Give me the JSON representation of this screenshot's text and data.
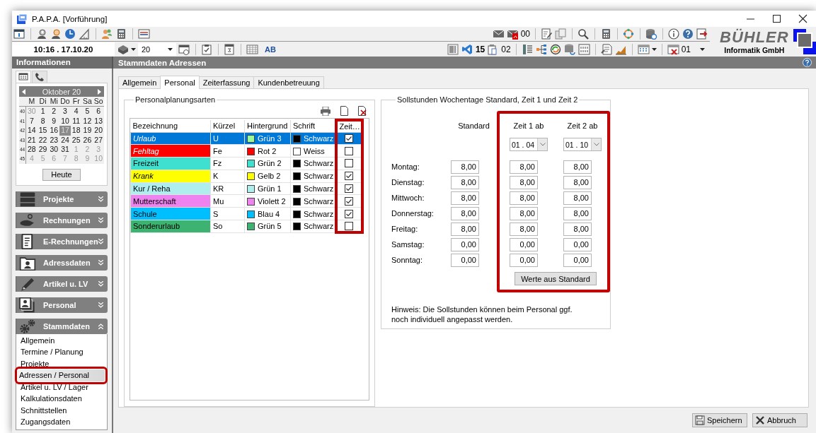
{
  "window": {
    "title": "P.A.P.A. [Vorführung]"
  },
  "toolbar": {
    "datetime": "10:16 . 17.10.20",
    "year": "20",
    "ab_label": "AB",
    "mail_count": "00",
    "vs_count": "15",
    "clip_count": "02",
    "grid_count": "01"
  },
  "logo": {
    "name": "BÜHLER",
    "subtitle": "Informatik GmbH"
  },
  "info_header": "Informationen",
  "page_header": "Stammdaten Adressen",
  "calendar_tabs": [
    {
      "kind": "calendar",
      "selected": true
    },
    {
      "kind": "phone",
      "selected": false
    }
  ],
  "calendar": {
    "month": "Oktober 20",
    "weekdays": [
      "M",
      "Di",
      "Mi",
      "Do",
      "Fr",
      "Sa",
      "So"
    ],
    "today_button": "Heute",
    "weeks": [
      {
        "number": "40",
        "days": [
          {
            "label": "30",
            "other_month": true,
            "selected": false
          },
          {
            "label": "1",
            "other_month": false,
            "selected": false
          },
          {
            "label": "2",
            "other_month": false,
            "selected": false
          },
          {
            "label": "3",
            "other_month": false,
            "selected": false
          },
          {
            "label": "4",
            "other_month": false,
            "selected": false
          },
          {
            "label": "5",
            "other_month": false,
            "selected": false
          },
          {
            "label": "6",
            "other_month": false,
            "selected": false
          }
        ]
      },
      {
        "number": "41",
        "days": [
          {
            "label": "7",
            "other_month": false,
            "selected": false
          },
          {
            "label": "8",
            "other_month": false,
            "selected": false
          },
          {
            "label": "9",
            "other_month": false,
            "selected": false
          },
          {
            "label": "10",
            "other_month": false,
            "selected": false
          },
          {
            "label": "11",
            "other_month": false,
            "selected": false
          },
          {
            "label": "12",
            "other_month": false,
            "selected": false
          },
          {
            "label": "13",
            "other_month": false,
            "selected": false
          }
        ]
      },
      {
        "number": "42",
        "days": [
          {
            "label": "14",
            "other_month": false,
            "selected": false
          },
          {
            "label": "15",
            "other_month": false,
            "selected": false
          },
          {
            "label": "16",
            "other_month": false,
            "selected": false
          },
          {
            "label": "17",
            "other_month": false,
            "selected": true
          },
          {
            "label": "18",
            "other_month": false,
            "selected": false
          },
          {
            "label": "19",
            "other_month": false,
            "selected": false
          },
          {
            "label": "20",
            "other_month": false,
            "selected": false
          }
        ]
      },
      {
        "number": "43",
        "days": [
          {
            "label": "21",
            "other_month": false,
            "selected": false
          },
          {
            "label": "22",
            "other_month": false,
            "selected": false
          },
          {
            "label": "23",
            "other_month": false,
            "selected": false
          },
          {
            "label": "24",
            "other_month": false,
            "selected": false
          },
          {
            "label": "25",
            "other_month": false,
            "selected": false
          },
          {
            "label": "26",
            "other_month": false,
            "selected": false
          },
          {
            "label": "27",
            "other_month": false,
            "selected": false
          }
        ]
      },
      {
        "number": "44",
        "days": [
          {
            "label": "28",
            "other_month": false,
            "selected": false
          },
          {
            "label": "29",
            "other_month": false,
            "selected": false
          },
          {
            "label": "30",
            "other_month": false,
            "selected": false
          },
          {
            "label": "31",
            "other_month": false,
            "selected": false
          },
          {
            "label": "1",
            "other_month": true,
            "selected": false
          },
          {
            "label": "2",
            "other_month": true,
            "selected": false
          },
          {
            "label": "3",
            "other_month": true,
            "selected": false
          }
        ]
      },
      {
        "number": "45",
        "days": [
          {
            "label": "4",
            "other_month": true,
            "selected": false
          },
          {
            "label": "5",
            "other_month": true,
            "selected": false
          },
          {
            "label": "6",
            "other_month": true,
            "selected": false
          },
          {
            "label": "7",
            "other_month": true,
            "selected": false
          },
          {
            "label": "8",
            "other_month": true,
            "selected": false
          },
          {
            "label": "9",
            "other_month": true,
            "selected": false
          },
          {
            "label": "10",
            "other_month": true,
            "selected": false
          }
        ]
      }
    ]
  },
  "nav_groups": [
    {
      "label": "Projekte",
      "kind": "server",
      "expanded": false
    },
    {
      "label": "Rechnungen",
      "kind": "hand",
      "expanded": false
    },
    {
      "label": "E-Rechnungen",
      "kind": "document",
      "expanded": false
    },
    {
      "label": "Adressdaten",
      "kind": "folder",
      "expanded": false
    },
    {
      "label": "Artikel u. LV",
      "kind": "pen",
      "expanded": false
    },
    {
      "label": "Personal",
      "kind": "photos",
      "expanded": false
    },
    {
      "label": "Stammdaten",
      "kind": "gears",
      "expanded": true,
      "items": [
        {
          "label": "Allgemein",
          "selected": false,
          "highlighted": false
        },
        {
          "label": "Termine / Planung",
          "selected": false,
          "highlighted": false
        },
        {
          "label": "Projekte",
          "selected": false,
          "highlighted": false
        },
        {
          "label": "Adressen / Personal",
          "selected": true,
          "highlighted": true
        },
        {
          "label": "Artikel u. LV / Lager",
          "selected": false,
          "highlighted": false
        },
        {
          "label": "Kalkulationsdaten",
          "selected": false,
          "highlighted": false
        },
        {
          "label": "Schnittstellen",
          "selected": false,
          "highlighted": false
        },
        {
          "label": "Zugangsdaten",
          "selected": false,
          "highlighted": false
        }
      ]
    }
  ],
  "tabs": [
    {
      "label": "Allgemein",
      "selected": false
    },
    {
      "label": "Personal",
      "selected": true
    },
    {
      "label": "Zeiterfassung",
      "selected": false
    },
    {
      "label": "Kundenbetreuung",
      "selected": false
    }
  ],
  "planning": {
    "title": "Personalplanungsarten",
    "columns": [
      {
        "label": "Bezeichnung",
        "highlighted": false
      },
      {
        "label": "Kürzel",
        "highlighted": false
      },
      {
        "label": "Hintergrund",
        "highlighted": false
      },
      {
        "label": "Schrift",
        "highlighted": false
      },
      {
        "label": "Zeit…",
        "highlighted": true
      }
    ],
    "rows": [
      {
        "name": "Urlaub",
        "italic": true,
        "selected": true,
        "code": "U",
        "background": {
          "label": "Grün 3",
          "color": "#98fb98"
        },
        "font": {
          "label": "Schwarz",
          "color": "#000000"
        },
        "zeit": true
      },
      {
        "name": "Fehltag",
        "italic": true,
        "selected": false,
        "code": "Fe",
        "background": {
          "label": "Rot 2",
          "color": "#ff0000"
        },
        "font": {
          "label": "Weiss",
          "color": "#ffffff"
        },
        "zeit": false
      },
      {
        "name": "Freizeit",
        "italic": false,
        "selected": false,
        "code": "Fz",
        "background": {
          "label": "Grün 2",
          "color": "#40e0d0"
        },
        "font": {
          "label": "Schwarz",
          "color": "#000000"
        },
        "zeit": false
      },
      {
        "name": "Krank",
        "italic": true,
        "selected": false,
        "code": "K",
        "background": {
          "label": "Gelb 2",
          "color": "#ffff00"
        },
        "font": {
          "label": "Schwarz",
          "color": "#000000"
        },
        "zeit": true
      },
      {
        "name": "Kur / Reha",
        "italic": false,
        "selected": false,
        "code": "KR",
        "background": {
          "label": "Grün 1",
          "color": "#afeeee"
        },
        "font": {
          "label": "Schwarz",
          "color": "#000000"
        },
        "zeit": true
      },
      {
        "name": "Mutterschaft",
        "italic": false,
        "selected": false,
        "code": "Mu",
        "background": {
          "label": "Violett 2",
          "color": "#ee82ee"
        },
        "font": {
          "label": "Schwarz",
          "color": "#000000"
        },
        "zeit": true
      },
      {
        "name": "Schule",
        "italic": false,
        "selected": false,
        "code": "S",
        "background": {
          "label": "Blau 4",
          "color": "#00bfff"
        },
        "font": {
          "label": "Schwarz",
          "color": "#000000"
        },
        "zeit": true
      },
      {
        "name": "Sonderurlaub",
        "italic": false,
        "selected": false,
        "code": "So",
        "background": {
          "label": "Grün 5",
          "color": "#3cb371"
        },
        "font": {
          "label": "Schwarz",
          "color": "#000000"
        },
        "zeit": false
      }
    ]
  },
  "hours": {
    "title": "Sollstunden Wochentage Standard, Zeit 1 und Zeit 2",
    "standard_label": "Standard",
    "zeit1_label": "Zeit 1 ab",
    "zeit2_label": "Zeit 2 ab",
    "zeit1_from": "01 . 04",
    "zeit2_from": "01 . 10",
    "zeit_highlighted": true,
    "days": [
      {
        "label": "Montag:",
        "standard": "8,00",
        "zeit1": "8,00",
        "zeit2": "8,00"
      },
      {
        "label": "Dienstag:",
        "standard": "8,00",
        "zeit1": "8,00",
        "zeit2": "8,00"
      },
      {
        "label": "Mittwoch:",
        "standard": "8,00",
        "zeit1": "8,00",
        "zeit2": "8,00"
      },
      {
        "label": "Donnerstag:",
        "standard": "8,00",
        "zeit1": "8,00",
        "zeit2": "8,00"
      },
      {
        "label": "Freitag:",
        "standard": "8,00",
        "zeit1": "8,00",
        "zeit2": "8,00"
      },
      {
        "label": "Samstag:",
        "standard": "0,00",
        "zeit1": "0,00",
        "zeit2": "0,00"
      },
      {
        "label": "Sonntag:",
        "standard": "0,00",
        "zeit1": "0,00",
        "zeit2": "0,00"
      }
    ],
    "copy_button": "Werte aus Standard",
    "note": "Hinweis: Die Sollstunden können beim Personal ggf. noch individuell angepasst werden."
  },
  "buttons": [
    {
      "label": "Speichern",
      "kind": "save"
    },
    {
      "label": "Abbruch",
      "kind": "cancel"
    }
  ]
}
